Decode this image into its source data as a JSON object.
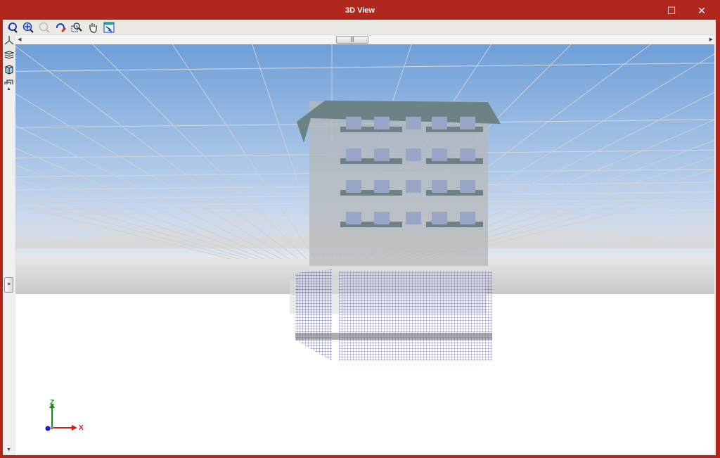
{
  "window": {
    "title": "3D View",
    "maximize_icon": "☐",
    "close_icon": "✕"
  },
  "toolbar": {
    "tools": [
      "rotate-view-icon",
      "zoom-all-icon",
      "zoom-previous-icon",
      "redraw-icon",
      "zoom-window-icon",
      "pan-hand-icon",
      "export-view-icon"
    ]
  },
  "left_toolbar": {
    "tools": [
      "axes-icon",
      "layers-icon",
      "solid-view-icon",
      "wireframe-box-icon"
    ]
  },
  "scrollbar": {
    "thumb_grip": "|||",
    "vertical_grip": "≡",
    "up": "▲",
    "down": "▼",
    "left": "◀",
    "right": "▶"
  },
  "axes": {
    "x": "X",
    "z": "Z"
  },
  "colors": {
    "titlebar": "#b0271e",
    "sky_top": "#6e9fd8",
    "sky_bottom": "#d6e3f2",
    "ground": "#ffffff",
    "axis_x": "#d41a1a",
    "axis_z": "#1a8a1a",
    "axis_y": "#1a1ae0"
  }
}
